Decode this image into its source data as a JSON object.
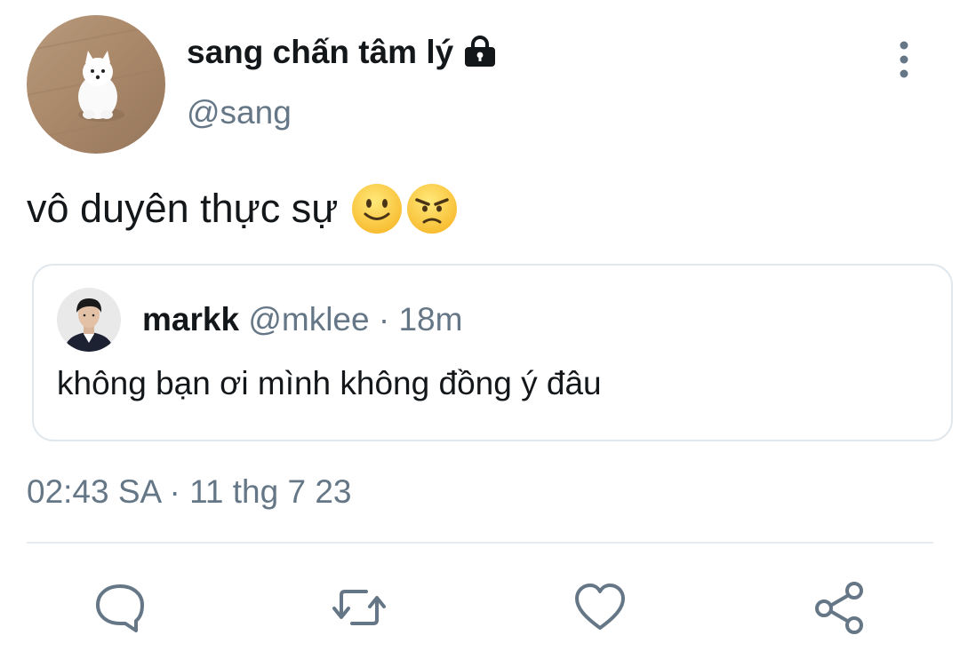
{
  "author": {
    "display_name": "sang chấn tâm lý",
    "handle": "@sang",
    "protected_icon": "lock-icon",
    "avatar": "white-puppy-photo"
  },
  "tweet": {
    "text": "vô duyên thực sự",
    "emojis": [
      "slightly-smiling-face",
      "angry-face"
    ]
  },
  "quoted_tweet": {
    "display_name": "markk",
    "meta": "@mklee · 18m",
    "text": "không bạn ơi mình không đồng ý đâu",
    "avatar": "person-photo"
  },
  "timestamp": "02:43 SA · 11 thg 7 23",
  "actions": [
    {
      "name": "reply",
      "icon": "speech-bubble-icon"
    },
    {
      "name": "retweet",
      "icon": "retweet-icon"
    },
    {
      "name": "like",
      "icon": "heart-icon"
    },
    {
      "name": "share",
      "icon": "share-icon"
    }
  ],
  "colors": {
    "text": "#14171a",
    "secondary": "#657786",
    "border": "#e1e8ed",
    "icon": "#657786"
  }
}
